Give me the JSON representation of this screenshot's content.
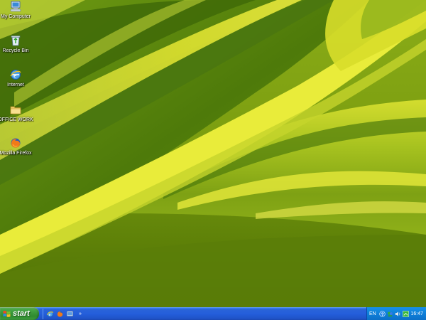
{
  "desktop": {
    "icons": [
      {
        "label": "My Computer",
        "icon": "my-computer-icon"
      },
      {
        "label": "Recycle Bin",
        "icon": "recycle-bin-icon"
      },
      {
        "label": "Internet",
        "icon": "internet-explorer-icon"
      },
      {
        "label": "OFFICE WORK",
        "icon": "folder-icon"
      },
      {
        "label": "Mozilla Firefox",
        "icon": "firefox-icon"
      }
    ]
  },
  "taskbar": {
    "start_label": "start",
    "quick_launch": [
      "internet-explorer-icon",
      "firefox-icon",
      "show-desktop-icon"
    ],
    "chevron": "»",
    "tray": {
      "language": "EN",
      "icons": [
        "help-icon",
        "msn-icon",
        "volume-icon",
        "network-icon"
      ],
      "clock": "16:47"
    }
  },
  "colors": {
    "taskbar_blue": "#245edb",
    "start_green": "#3c9a3c",
    "tray_blue": "#0f7fd8",
    "wallpaper_green": "#7a9a10",
    "wallpaper_yellow": "#e8ea28"
  }
}
